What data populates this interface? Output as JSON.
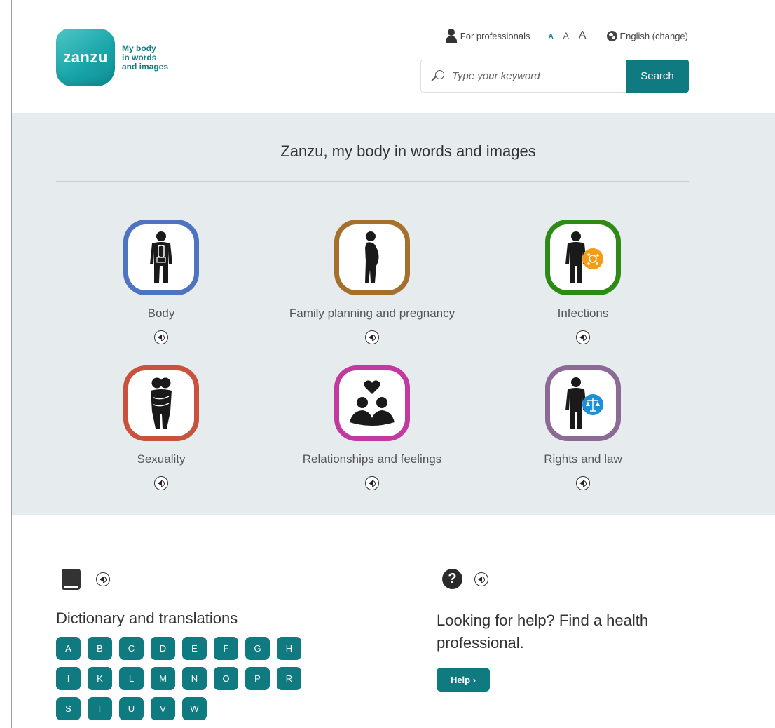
{
  "header": {
    "logo_text": "zanzu",
    "tagline": [
      "My body",
      "in words",
      "and images"
    ],
    "professionals_label": "For professionals",
    "font_sizes": [
      "A",
      "A",
      "A"
    ],
    "language_label": "English (change)",
    "search": {
      "placeholder": "Type your keyword",
      "value": "",
      "button_label": "Search"
    }
  },
  "hero": {
    "title": "Zanzu, my body in words and images",
    "categories": [
      {
        "label": "Body",
        "color": "#4e73c0",
        "icon": "body-icon"
      },
      {
        "label": "Family planning and pregnancy",
        "color": "#a5702b",
        "icon": "pregnancy-icon"
      },
      {
        "label": "Infections",
        "color": "#2e8a16",
        "icon": "infections-icon"
      },
      {
        "label": "Sexuality",
        "color": "#c9523c",
        "icon": "sexuality-icon"
      },
      {
        "label": "Relationships and feelings",
        "color": "#c23aa0",
        "icon": "relationships-icon"
      },
      {
        "label": "Rights and law",
        "color": "#8c6a96",
        "icon": "rights-icon"
      }
    ]
  },
  "dictionary": {
    "title": "Dictionary and translations",
    "letters": [
      "A",
      "B",
      "C",
      "D",
      "E",
      "F",
      "G",
      "H",
      "I",
      "K",
      "L",
      "M",
      "N",
      "O",
      "P",
      "R",
      "S",
      "T",
      "U",
      "V",
      "W"
    ]
  },
  "help": {
    "title": "Looking for help? Find a health professional.",
    "button_label": "Help ›"
  },
  "colors": {
    "brand": "#0f7b80",
    "hero_bg": "#e6ebee"
  }
}
